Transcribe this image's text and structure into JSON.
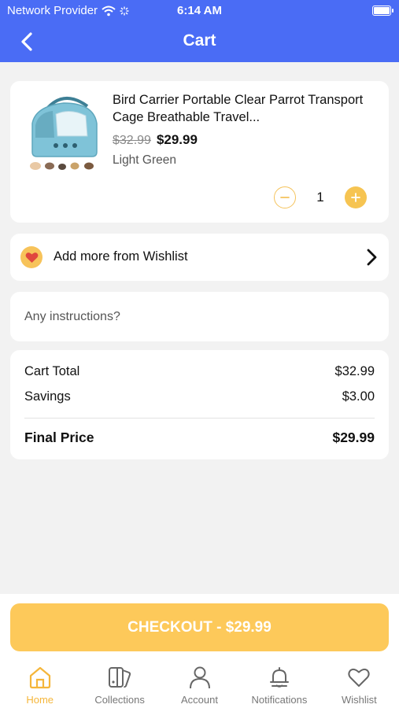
{
  "status_bar": {
    "carrier": "Network Provider",
    "time": "6:14 AM"
  },
  "nav": {
    "title": "Cart",
    "back_icon": "chevron-left-icon"
  },
  "cart_item": {
    "title": "Bird Carrier Portable Clear Parrot Transport Cage Breathable Travel...",
    "original_price": "$32.99",
    "sale_price": "$29.99",
    "variant": "Light Green",
    "quantity": "1",
    "minus_icon": "minus-circle-icon",
    "plus_icon": "plus-circle-icon"
  },
  "wishlist_link": {
    "label": "Add more from Wishlist",
    "icon": "heart-icon",
    "chevron_icon": "chevron-right-icon"
  },
  "instructions": {
    "placeholder": "Any instructions?",
    "value": ""
  },
  "summary": {
    "cart_total_label": "Cart Total",
    "cart_total_value": "$32.99",
    "savings_label": "Savings",
    "savings_value": "$3.00",
    "final_label": "Final Price",
    "final_value": "$29.99"
  },
  "checkout": {
    "label": "CHECKOUT - $29.99"
  },
  "tabs": [
    {
      "label": "Home",
      "icon": "home-icon",
      "active": true
    },
    {
      "label": "Collections",
      "icon": "collections-icon",
      "active": false
    },
    {
      "label": "Account",
      "icon": "account-icon",
      "active": false
    },
    {
      "label": "Notifications",
      "icon": "bell-icon",
      "active": false
    },
    {
      "label": "Wishlist",
      "icon": "heart-outline-icon",
      "active": false
    }
  ],
  "colors": {
    "header": "#4a6cf5",
    "accent": "#f6c452",
    "checkout": "#fdc95a",
    "active_tab": "#f5b63a",
    "background": "#f2f2f2"
  }
}
